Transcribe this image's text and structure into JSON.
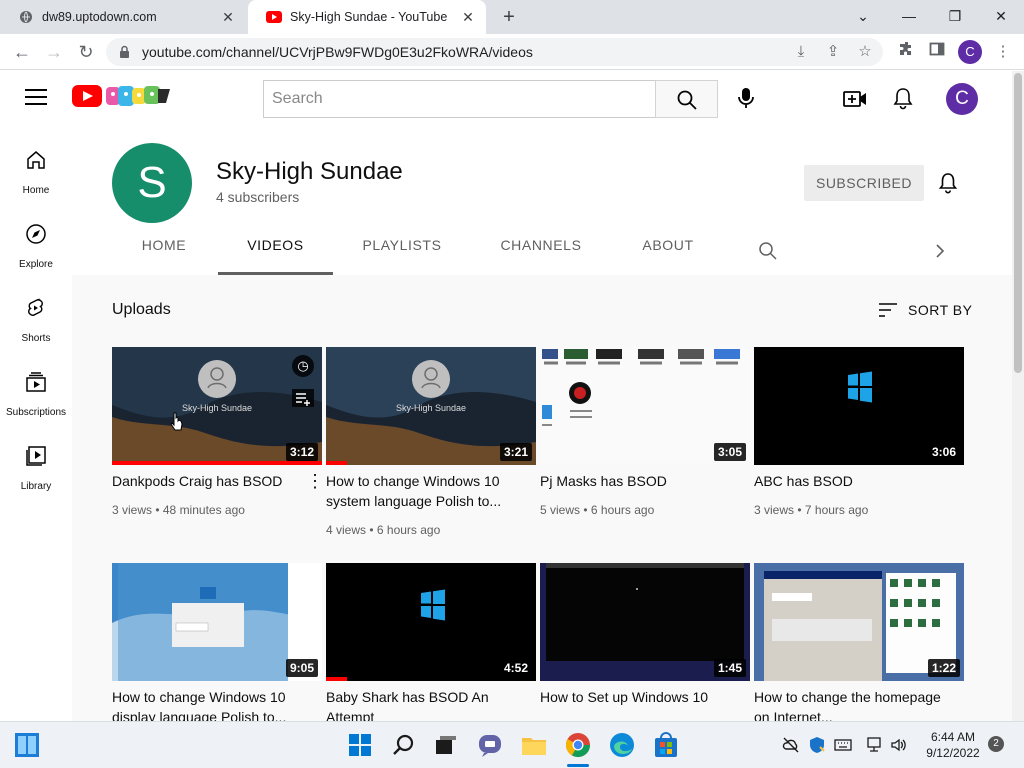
{
  "browser": {
    "tabs": [
      {
        "title": "dw89.uptodown.com",
        "active": false
      },
      {
        "title": "Sky-High Sundae - YouTube",
        "active": true
      }
    ],
    "url": "youtube.com/channel/UCVrjPBw9FWDg0E3u2FkoWRA/videos",
    "profile_initial": "C"
  },
  "youtube_header": {
    "search_placeholder": "Search",
    "avatar_initial": "C"
  },
  "guide": {
    "items": [
      {
        "label": "Home",
        "icon": "home-icon"
      },
      {
        "label": "Explore",
        "icon": "compass-icon"
      },
      {
        "label": "Shorts",
        "icon": "shorts-icon"
      },
      {
        "label": "Subscriptions",
        "icon": "subscriptions-icon"
      },
      {
        "label": "Library",
        "icon": "library-icon"
      }
    ]
  },
  "channel": {
    "avatar_letter": "S",
    "avatar_color": "#168d6b",
    "name": "Sky-High Sundae",
    "subscribers": "4 subscribers",
    "subscribe_label": "SUBSCRIBED",
    "tabs": [
      "HOME",
      "VIDEOS",
      "PLAYLISTS",
      "CHANNELS",
      "ABOUT"
    ],
    "active_tab": "VIDEOS"
  },
  "uploads": {
    "heading": "Uploads",
    "sort_label": "SORT BY",
    "videos": [
      {
        "title": "Dankpods Craig has BSOD",
        "meta": "3 views • 48 minutes ago",
        "duration": "3:12",
        "watched": 1.0
      },
      {
        "title": "How to change Windows 10 system language Polish to...",
        "meta": "4 views • 6 hours ago",
        "duration": "3:21",
        "watched": 0.1
      },
      {
        "title": "Pj Masks has BSOD",
        "meta": "5 views • 6 hours ago",
        "duration": "3:05",
        "watched": 0
      },
      {
        "title": "ABC has BSOD",
        "meta": "3 views • 7 hours ago",
        "duration": "3:06",
        "watched": 0
      },
      {
        "title": "How to change Windows 10 display language Polish to...",
        "meta": "",
        "duration": "9:05",
        "watched": 0
      },
      {
        "title": "Baby Shark has BSOD An Attempt",
        "meta": "",
        "duration": "4:52",
        "watched": 0.1
      },
      {
        "title": "How to Set up Windows 10",
        "meta": "",
        "duration": "1:45",
        "watched": 0
      },
      {
        "title": "How to change the homepage on Internet...",
        "meta": "",
        "duration": "1:22",
        "watched": 0
      }
    ],
    "thumb_overlay_text": "Sky-High Sundae"
  },
  "taskbar": {
    "time": "6:44 AM",
    "date": "9/12/2022",
    "notifications": "2"
  }
}
